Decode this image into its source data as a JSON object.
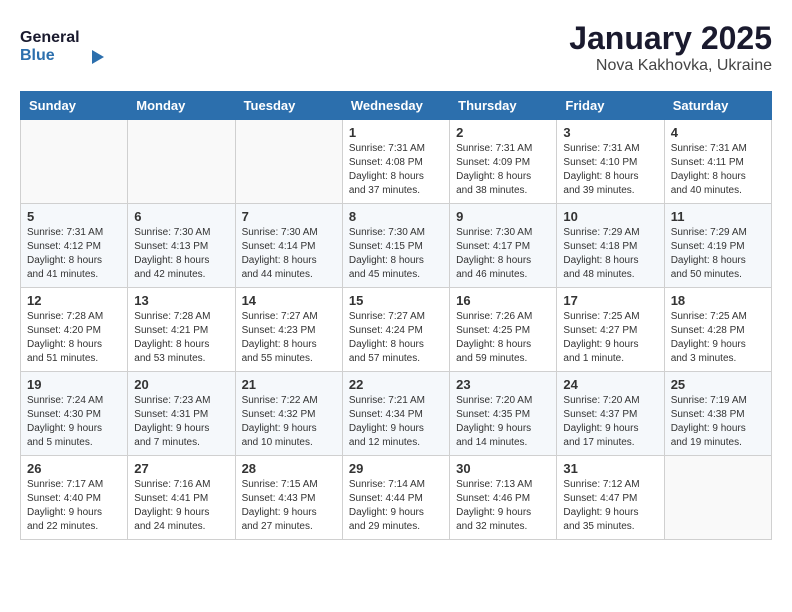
{
  "header": {
    "logo_general": "General",
    "logo_blue": "Blue",
    "title": "January 2025",
    "location": "Nova Kakhovka, Ukraine"
  },
  "weekdays": [
    "Sunday",
    "Monday",
    "Tuesday",
    "Wednesday",
    "Thursday",
    "Friday",
    "Saturday"
  ],
  "weeks": [
    [
      {
        "day": "",
        "info": ""
      },
      {
        "day": "",
        "info": ""
      },
      {
        "day": "",
        "info": ""
      },
      {
        "day": "1",
        "info": "Sunrise: 7:31 AM\nSunset: 4:08 PM\nDaylight: 8 hours and 37 minutes."
      },
      {
        "day": "2",
        "info": "Sunrise: 7:31 AM\nSunset: 4:09 PM\nDaylight: 8 hours and 38 minutes."
      },
      {
        "day": "3",
        "info": "Sunrise: 7:31 AM\nSunset: 4:10 PM\nDaylight: 8 hours and 39 minutes."
      },
      {
        "day": "4",
        "info": "Sunrise: 7:31 AM\nSunset: 4:11 PM\nDaylight: 8 hours and 40 minutes."
      }
    ],
    [
      {
        "day": "5",
        "info": "Sunrise: 7:31 AM\nSunset: 4:12 PM\nDaylight: 8 hours and 41 minutes."
      },
      {
        "day": "6",
        "info": "Sunrise: 7:30 AM\nSunset: 4:13 PM\nDaylight: 8 hours and 42 minutes."
      },
      {
        "day": "7",
        "info": "Sunrise: 7:30 AM\nSunset: 4:14 PM\nDaylight: 8 hours and 44 minutes."
      },
      {
        "day": "8",
        "info": "Sunrise: 7:30 AM\nSunset: 4:15 PM\nDaylight: 8 hours and 45 minutes."
      },
      {
        "day": "9",
        "info": "Sunrise: 7:30 AM\nSunset: 4:17 PM\nDaylight: 8 hours and 46 minutes."
      },
      {
        "day": "10",
        "info": "Sunrise: 7:29 AM\nSunset: 4:18 PM\nDaylight: 8 hours and 48 minutes."
      },
      {
        "day": "11",
        "info": "Sunrise: 7:29 AM\nSunset: 4:19 PM\nDaylight: 8 hours and 50 minutes."
      }
    ],
    [
      {
        "day": "12",
        "info": "Sunrise: 7:28 AM\nSunset: 4:20 PM\nDaylight: 8 hours and 51 minutes."
      },
      {
        "day": "13",
        "info": "Sunrise: 7:28 AM\nSunset: 4:21 PM\nDaylight: 8 hours and 53 minutes."
      },
      {
        "day": "14",
        "info": "Sunrise: 7:27 AM\nSunset: 4:23 PM\nDaylight: 8 hours and 55 minutes."
      },
      {
        "day": "15",
        "info": "Sunrise: 7:27 AM\nSunset: 4:24 PM\nDaylight: 8 hours and 57 minutes."
      },
      {
        "day": "16",
        "info": "Sunrise: 7:26 AM\nSunset: 4:25 PM\nDaylight: 8 hours and 59 minutes."
      },
      {
        "day": "17",
        "info": "Sunrise: 7:25 AM\nSunset: 4:27 PM\nDaylight: 9 hours and 1 minute."
      },
      {
        "day": "18",
        "info": "Sunrise: 7:25 AM\nSunset: 4:28 PM\nDaylight: 9 hours and 3 minutes."
      }
    ],
    [
      {
        "day": "19",
        "info": "Sunrise: 7:24 AM\nSunset: 4:30 PM\nDaylight: 9 hours and 5 minutes."
      },
      {
        "day": "20",
        "info": "Sunrise: 7:23 AM\nSunset: 4:31 PM\nDaylight: 9 hours and 7 minutes."
      },
      {
        "day": "21",
        "info": "Sunrise: 7:22 AM\nSunset: 4:32 PM\nDaylight: 9 hours and 10 minutes."
      },
      {
        "day": "22",
        "info": "Sunrise: 7:21 AM\nSunset: 4:34 PM\nDaylight: 9 hours and 12 minutes."
      },
      {
        "day": "23",
        "info": "Sunrise: 7:20 AM\nSunset: 4:35 PM\nDaylight: 9 hours and 14 minutes."
      },
      {
        "day": "24",
        "info": "Sunrise: 7:20 AM\nSunset: 4:37 PM\nDaylight: 9 hours and 17 minutes."
      },
      {
        "day": "25",
        "info": "Sunrise: 7:19 AM\nSunset: 4:38 PM\nDaylight: 9 hours and 19 minutes."
      }
    ],
    [
      {
        "day": "26",
        "info": "Sunrise: 7:17 AM\nSunset: 4:40 PM\nDaylight: 9 hours and 22 minutes."
      },
      {
        "day": "27",
        "info": "Sunrise: 7:16 AM\nSunset: 4:41 PM\nDaylight: 9 hours and 24 minutes."
      },
      {
        "day": "28",
        "info": "Sunrise: 7:15 AM\nSunset: 4:43 PM\nDaylight: 9 hours and 27 minutes."
      },
      {
        "day": "29",
        "info": "Sunrise: 7:14 AM\nSunset: 4:44 PM\nDaylight: 9 hours and 29 minutes."
      },
      {
        "day": "30",
        "info": "Sunrise: 7:13 AM\nSunset: 4:46 PM\nDaylight: 9 hours and 32 minutes."
      },
      {
        "day": "31",
        "info": "Sunrise: 7:12 AM\nSunset: 4:47 PM\nDaylight: 9 hours and 35 minutes."
      },
      {
        "day": "",
        "info": ""
      }
    ]
  ]
}
